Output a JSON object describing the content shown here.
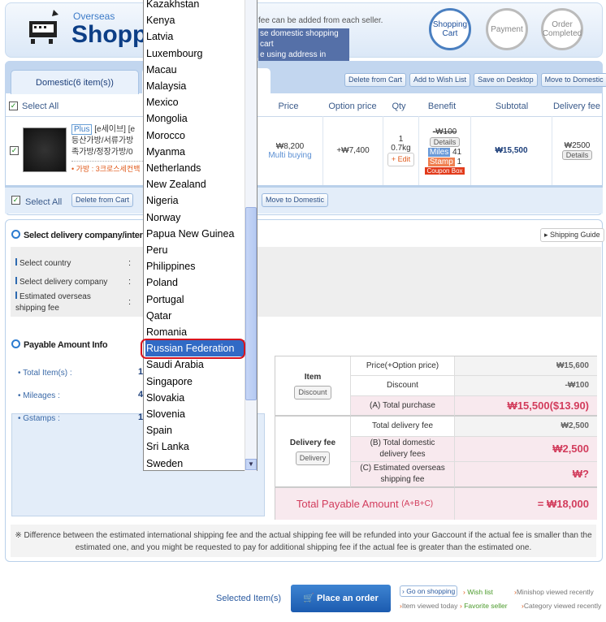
{
  "header": {
    "logo_small": "Overseas",
    "logo_big": "Shoppi",
    "notice_line1": "fee can be added from each seller.",
    "notice_line2": "se domestic shopping cart",
    "notice_line3": "e using address in Korea.",
    "steps": [
      {
        "num": "1",
        "label": "Shopping Cart"
      },
      {
        "num": "2",
        "label": "Payment"
      },
      {
        "num": "3",
        "label": "Order Completed"
      }
    ]
  },
  "cart": {
    "tab_domestic": "Domestic(6 item(s))",
    "actions": [
      "Delete from Cart",
      "Add to Wish List",
      "Save on Desktop",
      "Move to Domestic"
    ],
    "select_all": "Select All",
    "columns": {
      "price": "Price",
      "option_price": "Option price",
      "qty": "Qty",
      "benefit": "Benefit",
      "subtotal": "Subtotal",
      "delivery_fee": "Delivery fee"
    },
    "item": {
      "badge": "Plus",
      "title_line1": "[e세이브] [e",
      "title_line2": "등산가방/서류가방",
      "title_line3": "족가방/정장가방/0",
      "option": "• 가방 : 3크로스세컨백",
      "price": "₩8,200",
      "price_note": "Multi buying",
      "option_price": "+₩7,400",
      "qty": "1",
      "weight": "0.7kg",
      "edit": "+ Edit",
      "discount": "-₩100",
      "details": "Details",
      "miles_label": "Miles",
      "miles": "41",
      "stamp_label": "Stamp",
      "stamp": "1",
      "coupon": "Coupon Box",
      "subtotal": "₩15,500",
      "delivery_fee": "₩2500",
      "delivery_details": "Details"
    },
    "bottom": {
      "select_all": "Select All",
      "delete": "Delete from Cart",
      "move": "Move to Domestic"
    }
  },
  "delivery": {
    "title": "Select delivery company/inter",
    "shipping_guide": "Shipping Guide",
    "select_country": "Select country",
    "select_company": "Select delivery company",
    "est_fee_1": "Estimated overseas",
    "est_fee_2": "shipping fee",
    "colon": ":"
  },
  "payable": {
    "title": "Payable Amount Info",
    "total_items": "Total Item(s) :",
    "total_items_val": "1",
    "mileages": "Mileages :",
    "mileages_val": "4",
    "gstamps": "Gstamps :",
    "gstamps_val": "1"
  },
  "summary": {
    "item_label": "Item",
    "discount_btn": "Discount",
    "price_label": "Price(+Option price)",
    "price_val": "₩15,600",
    "discount_label": "Discount",
    "discount_val": "-₩100",
    "total_purchase_label": "(A) Total purchase",
    "total_purchase_val": "₩15,500($13.90)",
    "delivery_label": "Delivery fee",
    "delivery_btn": "Delivery",
    "total_delivery_label": "Total delivery fee",
    "total_delivery_val": "₩2,500",
    "domestic_label": "(B) Total domestic delivery fees",
    "domestic_val": "₩2,500",
    "overseas_label": "(C) Estimated overseas shipping fee",
    "overseas_val": "₩?",
    "total_label": "Total Payable Amount",
    "total_formula": "(A+B+C)",
    "total_val": "= ₩18,000"
  },
  "note": "※ Difference between the estimated international shipping fee and the actual shipping fee will be refunded into your Gaccount if the actual fee is smaller than the estimated one, and you might be requested to pay for additional shipping fee if the actual fee is greater than the estimated one.",
  "footer": {
    "selected": "Selected Item(s)",
    "place_order": "Place an order",
    "go_shopping": "Go on shopping",
    "wish_list": "Wish list",
    "minishop": "Minishop viewed recently",
    "item_today": "Item viewed today",
    "favorite": "Favorite seller",
    "category": "Category viewed recently"
  },
  "dropdown": {
    "selected": "Russian Federation",
    "options": [
      "Kazakhstan",
      "Kenya",
      "Latvia",
      "Luxembourg",
      "Macau",
      "Malaysia",
      "Mexico",
      "Mongolia",
      "Morocco",
      "Myanma",
      "Netherlands",
      "New Zealand",
      "Nigeria",
      "Norway",
      "Papua New Guinea",
      "Peru",
      "Philippines",
      "Poland",
      "Portugal",
      "Qatar",
      "Romania",
      "Russian Federation",
      "Saudi Arabia",
      "Singapore",
      "Slovakia",
      "Slovenia",
      "Spain",
      "Sri Lanka",
      "Sweden"
    ]
  },
  "colors": {
    "accent": "#316ac5",
    "highlight_ring": "#d7141e",
    "price_red": "#d23c5c"
  }
}
